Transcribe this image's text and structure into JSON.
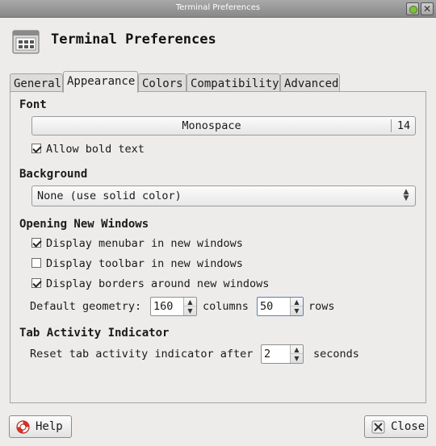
{
  "window": {
    "title": "Terminal Preferences"
  },
  "header": {
    "title": "Terminal Preferences",
    "icon": "terminal-preferences-icon"
  },
  "tabs": [
    {
      "label": "General",
      "mnemonic": "G",
      "active": false
    },
    {
      "label": "Appearance",
      "mnemonic": "p",
      "active": true
    },
    {
      "label": "Colors",
      "mnemonic": "o",
      "active": false
    },
    {
      "label": "Compatibility",
      "mnemonic": "m",
      "active": false
    },
    {
      "label": "Advanced",
      "mnemonic": "v",
      "active": false
    }
  ],
  "font": {
    "heading": "Font",
    "name": "Monospace",
    "size": "14",
    "allow_bold_label": "Allow bold text",
    "allow_bold_checked": true
  },
  "background": {
    "heading": "Background",
    "selected": "None (use solid color)"
  },
  "opening": {
    "heading": "Opening New Windows",
    "menubar_label": "Display menubar in new windows",
    "menubar_checked": true,
    "toolbar_label": "Display toolbar in new windows",
    "toolbar_checked": false,
    "borders_label": "Display borders around new windows",
    "borders_checked": true,
    "geometry_label": "Default geometry:",
    "columns_value": "160",
    "columns_label": "columns",
    "rows_value": "50",
    "rows_label": "rows"
  },
  "tab_activity": {
    "heading": "Tab Activity Indicator",
    "reset_label": "Reset tab activity indicator after",
    "value": "2",
    "unit_label": "seconds"
  },
  "buttons": {
    "help": "Help",
    "close": "Close"
  }
}
